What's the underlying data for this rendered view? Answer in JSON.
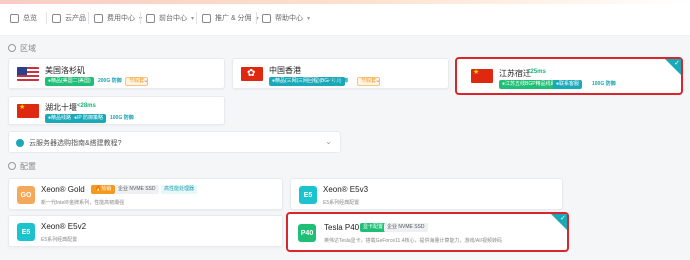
{
  "nav": {
    "items": [
      {
        "label": "总览",
        "icon": "home-icon"
      },
      {
        "label": "云产品",
        "icon": "cloud-icon"
      },
      {
        "label": "费用中心",
        "icon": "wallet-icon"
      },
      {
        "label": "前台中心",
        "icon": "grid-icon"
      },
      {
        "label": "推广 & 分佣",
        "icon": "user-icon"
      },
      {
        "label": "帮助中心",
        "icon": "help-icon"
      }
    ]
  },
  "region": {
    "title": "区域",
    "cards": [
      {
        "name": "美国洛杉矶",
        "tags": [
          "●精品(美国二|美国)",
          "200G 防御"
        ],
        "extra": "节假套"
      },
      {
        "name": "中国香港",
        "tags": [
          "●精品(三网|三网回程)|BGP线路",
          "无限防御"
        ],
        "extra": "节假套"
      },
      {
        "name": "江苏宿迁",
        "latency": "<25ms",
        "tags": [
          "●江苏五线BGP精品线路",
          "●联系客服",
          "100G 防御"
        ]
      },
      {
        "name": "湖北十堰",
        "latency": "<28ms",
        "tags": [
          "●精品线路",
          "●IP 防御策略",
          "100G 防御"
        ]
      }
    ],
    "tip": "云服务器选购指南&搭建教程?"
  },
  "config": {
    "title": "配置",
    "cards": [
      {
        "badge": "GO",
        "title": "Xeon® Gold",
        "tags": [
          "🔥热销",
          "企业 NVME SSD"
        ],
        "extra": "高性能处理器",
        "desc": "新一代Intel®金牌系列，性能高韧爆强"
      },
      {
        "badge": "E5",
        "title": "Xeon® E5v3",
        "desc": "E5系列经典配置"
      },
      {
        "badge": "E5",
        "title": "Xeon® E5v2",
        "desc": "E5系列经典配置"
      },
      {
        "badge": "P40",
        "title": "Tesla P40",
        "tags": [
          "显卡配置",
          "企业 NVME SSD"
        ],
        "desc": "英伟达Tesla显卡，搭载GeForce11.4核心，提供海量计算能力，游戏/AI/视频转码"
      }
    ]
  }
}
